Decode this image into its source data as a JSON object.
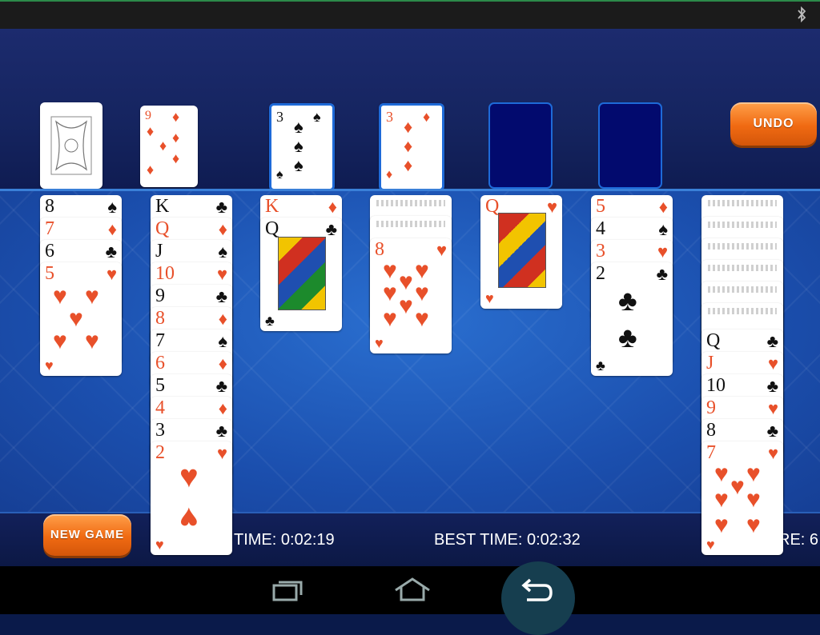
{
  "colors": {
    "accent": "#f07a1a",
    "table": "#1d58b8",
    "empty_slot": "#020a6e",
    "red_suit": "#e8502a"
  },
  "buttons": {
    "undo": "UNDO",
    "new_game": "NEW GAME"
  },
  "stats": {
    "time": "TIME: 0:02:19",
    "best_time": "BEST TIME: 0:02:32",
    "score_partial": "RE: 6"
  },
  "stock": {
    "icon": "card-back"
  },
  "waste": {
    "rank": "9",
    "suit": "♦"
  },
  "foundations": [
    {
      "rank": "3",
      "suit": "♠"
    },
    {
      "rank": "3",
      "suit": "♦"
    },
    {
      "rank": "",
      "suit": ""
    },
    {
      "rank": "",
      "suit": ""
    }
  ],
  "tableau": {
    "col1": [
      "8",
      "7",
      "6",
      "5"
    ],
    "col2": [
      "K",
      "Q",
      "J",
      "10",
      "9",
      "8",
      "7",
      "6",
      "5",
      "4",
      "3",
      "2"
    ],
    "col3": [
      "K",
      "Q"
    ],
    "col4": [
      "8"
    ],
    "col5": [
      "Q"
    ],
    "col6": [
      "5",
      "4",
      "3",
      "2"
    ],
    "col7": [
      "Q",
      "J",
      "10",
      "9",
      "8",
      "7"
    ]
  },
  "suits": {
    "spade": "♠",
    "club": "♣",
    "heart": "♥",
    "diamond": "♦"
  }
}
